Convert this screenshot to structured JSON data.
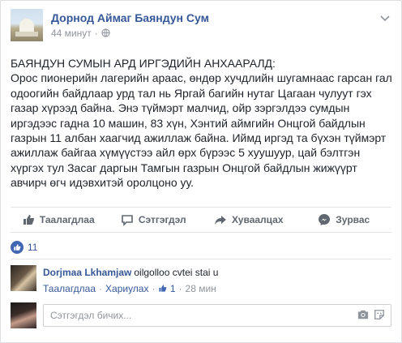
{
  "post": {
    "page_name": "Дорнод Аймаг Баяндун Сум",
    "time": "44 минут",
    "separator": "·",
    "body": "БАЯНДУН СУМЫН АРД ИРГЭДИЙН АНХААРАЛД:\nОрос пионерийн лагерийн араас, өндөр хучдлийн шугамнаас гарсан гал одоогийн байдлаар урд тал нь Яргай багийн нутаг Цагаан чулуут гэх газар хүрээд байна. Энэ түймэрт малчид, ойр зэргэлдээ сумдын иргэдээс гадна 10 машин, 83 хүн, Хэнтий аймгийн Онцгой байдлын газрын 11 албан хаагчид ажиллаж байна. Иймд иргэд та бүхэн түймэрт ажиллаж байгаа хүмүүстээ айл өрх бүрээс 5 хуушуур, цай бэлтгэн хүргэх тул Засаг даргын Тамгын газрын Онцгой байдлын жижүүрт авчирч өгч идэвхитэй оролцоно уу."
  },
  "actions": {
    "like": "Таалагдлаа",
    "comment": "Сэтгэгдэл",
    "share": "Хуваалцах",
    "messenger": "Зурвас"
  },
  "reactions": {
    "count": "11"
  },
  "comment": {
    "author": "Dorjmaa Lkhamjaw",
    "text": "oilgolloo cvtei stai u",
    "like_link": "Таалагдлаа",
    "reply_link": "Хариулах",
    "like_count": "1",
    "time": "28 мин",
    "dot": "·"
  },
  "composer": {
    "placeholder": "Сэтгэгдэл бичих..."
  },
  "colors": {
    "link": "#365899",
    "muted": "#90949c",
    "like_blue": "#4267b2"
  },
  "icons": [
    "globe-icon",
    "options-icon",
    "like-icon",
    "comment-icon",
    "share-icon",
    "messenger-icon",
    "camera-icon",
    "sticker-icon"
  ]
}
